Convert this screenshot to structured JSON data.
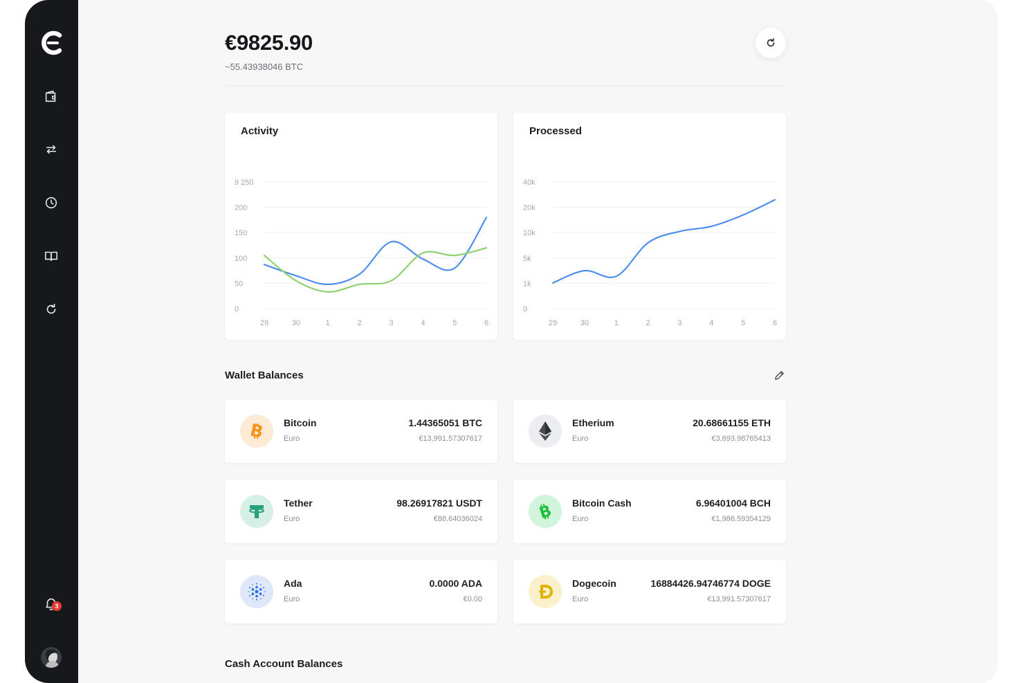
{
  "sidebar": {
    "nav": [
      {
        "icon": "wallet-icon"
      },
      {
        "icon": "transfer-icon"
      },
      {
        "icon": "clock-icon"
      },
      {
        "icon": "book-icon"
      },
      {
        "icon": "refresh-icon"
      }
    ],
    "notifications": {
      "icon": "bell-icon",
      "count": "3"
    },
    "avatar": {
      "icon": "avatar-icon"
    }
  },
  "header": {
    "total_balance": "€9825.90",
    "btc_equivalent": "~55.43938046 BTC",
    "refresh_icon": "refresh-icon"
  },
  "charts": {
    "activity_title": "Activity",
    "processed_title": "Processed"
  },
  "chart_data": [
    {
      "type": "line",
      "title": "Activity",
      "xlabel": "",
      "ylabel": "",
      "categories": [
        "29",
        "30",
        "1",
        "2",
        "3",
        "4",
        "5",
        "6"
      ],
      "y_tick_labels": [
        "0",
        "50",
        "100",
        "150",
        "200",
        "9 250"
      ],
      "ylim": [
        0,
        250
      ],
      "grid": true,
      "series": [
        {
          "color": "#4f8ff0",
          "values": [
            87,
            65,
            48,
            68,
            132,
            98,
            80,
            180
          ]
        },
        {
          "color": "#8fd16f",
          "values": [
            105,
            55,
            33,
            48,
            55,
            110,
            105,
            120
          ]
        }
      ]
    },
    {
      "type": "line",
      "title": "Processed",
      "xlabel": "",
      "ylabel": "",
      "categories": [
        "29",
        "30",
        "1",
        "2",
        "3",
        "4",
        "5",
        "6"
      ],
      "y_tick_labels": [
        "0",
        "1k",
        "5k",
        "10k",
        "20k",
        "40k"
      ],
      "grid": true,
      "series": [
        {
          "color": "#4f8ff0",
          "values": [
            1.05,
            3.0,
            2.1,
            8.0,
            10.5,
            12.5,
            17.0,
            26.0
          ]
        }
      ]
    }
  ],
  "sections": {
    "wallet_balances": "Wallet Balances",
    "cash_account_balances": "Cash Account Balances",
    "edit_icon": "pencil-icon"
  },
  "wallets": [
    {
      "name": "Bitcoin",
      "fiat": "Euro",
      "amount": "1.44365051 BTC",
      "value": "€13,991.57307617",
      "icon": "bitcoin-icon",
      "color": "#f7931a"
    },
    {
      "name": "Etherium",
      "fiat": "Euro",
      "amount": "20.68661155 ETH",
      "value": "€3,693.98765413",
      "icon": "ethereum-icon",
      "color": "#3c3c3d"
    },
    {
      "name": "Tether",
      "fiat": "Euro",
      "amount": "98.26917821 USDT",
      "value": "€88.64036024",
      "icon": "tether-icon",
      "color": "#26a17b"
    },
    {
      "name": "Bitcoin Cash",
      "fiat": "Euro",
      "amount": "6.96401004 BCH",
      "value": "€1,986.59354129",
      "icon": "bitcoin-cash-icon",
      "color": "#0ac18e"
    },
    {
      "name": "Ada",
      "fiat": "Euro",
      "amount": "0.0000 ADA",
      "value": "€0.00",
      "icon": "cardano-icon",
      "color": "#2a6ae3"
    },
    {
      "name": "Dogecoin",
      "fiat": "Euro",
      "amount": "16884426.94746774 DOGE",
      "value": "€13,991.57307617",
      "icon": "dogecoin-icon",
      "color": "#e1b303"
    }
  ]
}
